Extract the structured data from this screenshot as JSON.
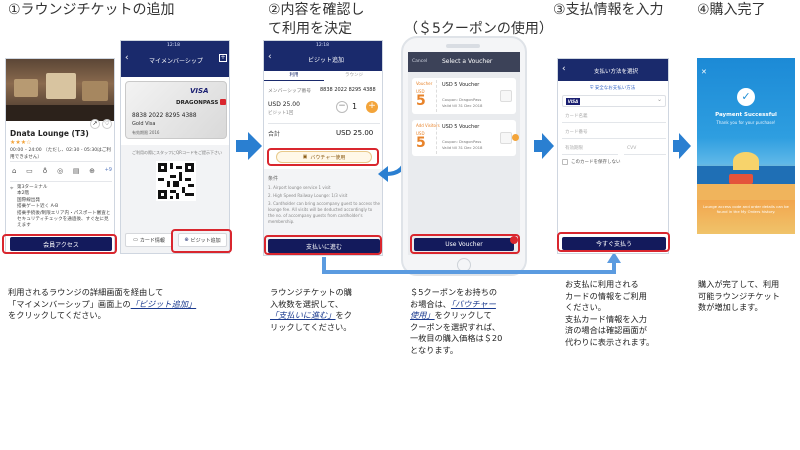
{
  "steps": {
    "s1_title": "①ラウンジチケットの追加",
    "s2_title_l1": "②内容を確認し",
    "s2_title_l2": "て利用を決定",
    "s2b_title": "（＄5クーポンの使用）",
    "s3_title": "③支払情報を入力",
    "s4_title": "④購入完了"
  },
  "desc1": {
    "l1": "利用されるラウンジの詳細画面を経由して",
    "l2a": "「マイメンバーシップ」画面上の",
    "l2b": "「ビジット追加」",
    "l3": "をクリックしてください。"
  },
  "desc2": {
    "l1": "ラウンジチケットの購",
    "l2": "入枚数を選択して、",
    "l3a": "「支払いに進む」",
    "l3b": "をク",
    "l4": "リックしてください。"
  },
  "desc2b": {
    "l1": "＄5クーポンをお持ちの",
    "l2a": "お場合は、",
    "l2b": "「バウチャー",
    "l3a": "使用」",
    "l3b": "をクリックして",
    "l4": "クーポンを選択すれば、",
    "l5": "一枚目の購入価格は＄20",
    "l6": "となります。"
  },
  "desc3": {
    "l1": "お支払に利用される",
    "l2": "カードの情報をご利用",
    "l3": "ください。",
    "l4": "支払カード情報を入力",
    "l5": "済の場合は確認画面が",
    "l6": "代わりに表示されます。"
  },
  "desc4": {
    "l1": "購入が完了して、利用",
    "l2": "可能ラウンジチケット",
    "l3": "数が増加します。"
  },
  "p1": {
    "lounge_name": "Dnata Lounge (T3)",
    "rating": "★★★☆",
    "hours": "00:00 – 24:00 （ただし、02:30 - 05:30はご利用できません）",
    "terminal": "第3ターミナル",
    "info1": "本2階",
    "info2": "国際線出発",
    "info3": "搭乗ゲート近く A-B",
    "info4": "搭乗手続後/制限エリア内・パスポート審査と",
    "info5": "セキュリティチェックを通過後、すぐ左に見えます",
    "access_button": "会員アクセス",
    "amenity_count": "+9"
  },
  "p1b": {
    "status_time": "12:18",
    "header": "マイメンバーシップ",
    "card_brand": "VISA",
    "card_logo": "DRAGONPASS",
    "card_number": "8838 2022 8295 4388",
    "card_type": "Gold Visa",
    "card_expiry": "有効期限 2016",
    "qr_hint": "ご利用の際にスタッフにQRコードをご提示下さい",
    "card_info_button": "カード情報",
    "add_visit_button": "ビジット追加"
  },
  "p2": {
    "status_time": "12:18",
    "header": "ビジット追加",
    "tab_left": "利用",
    "tab_right": "ラウンジ",
    "member_label": "メンバーシップ番号",
    "member_number": "8838 2022 8295 4388",
    "price": "USD 25.00",
    "price_sub": "ビジット1回",
    "quantity": "1",
    "total_label": "合計",
    "total_value": "USD 25.00",
    "voucher_button": "バウチャー使用",
    "terms_title": "条件",
    "term1": "1. Airport lounge service 1 visit",
    "term2": "2. High Speed Railway Lounge: 1/3 visit",
    "term3": "3. Cardholder can bring accompany guest to access the lounge fee. All visits will be deducted accordingly to the no. of accompany guests from cardholder's membership.",
    "proceed_button": "支払いに進む"
  },
  "p2b": {
    "cancel": "Cancel",
    "header": "Select a Voucher",
    "v1_label": "Voucher",
    "v1_title": "USD 5 Voucher",
    "v1_amount": "5",
    "v1_currency": "USD",
    "v1_code": "Coupon: DragonPass",
    "v1_valid": "Valid till 31 Dec 2018",
    "v2_label": "Add Visitors",
    "v2_title": "USD 5 Voucher",
    "v2_amount": "5",
    "v2_currency": "USD",
    "v2_code": "Coupon: DragonPass",
    "v2_valid": "Valid till 31 Dec 2018",
    "use_button": "Use Voucher"
  },
  "p3": {
    "header": "支払い方法を選択",
    "secure": "安全なお支払い方法",
    "card_brand": "VISA",
    "name_placeholder": "カード名義",
    "number_placeholder": "カード番号",
    "expiry_placeholder": "有効期限",
    "cvv_placeholder": "CVV",
    "save_card": "このカードを保存しない",
    "pay_button": "今すぐ支払う"
  },
  "p4": {
    "title": "Payment Successful",
    "subtitle": "Thank you for your purchase!",
    "footer": "Lounge access code and order details can be found in the My Orders history."
  },
  "colors": {
    "navy": "#131a5c",
    "red_box": "#d9262e",
    "arrow_blue": "#2a7fd1",
    "success_blue": "#1f8fd6"
  }
}
